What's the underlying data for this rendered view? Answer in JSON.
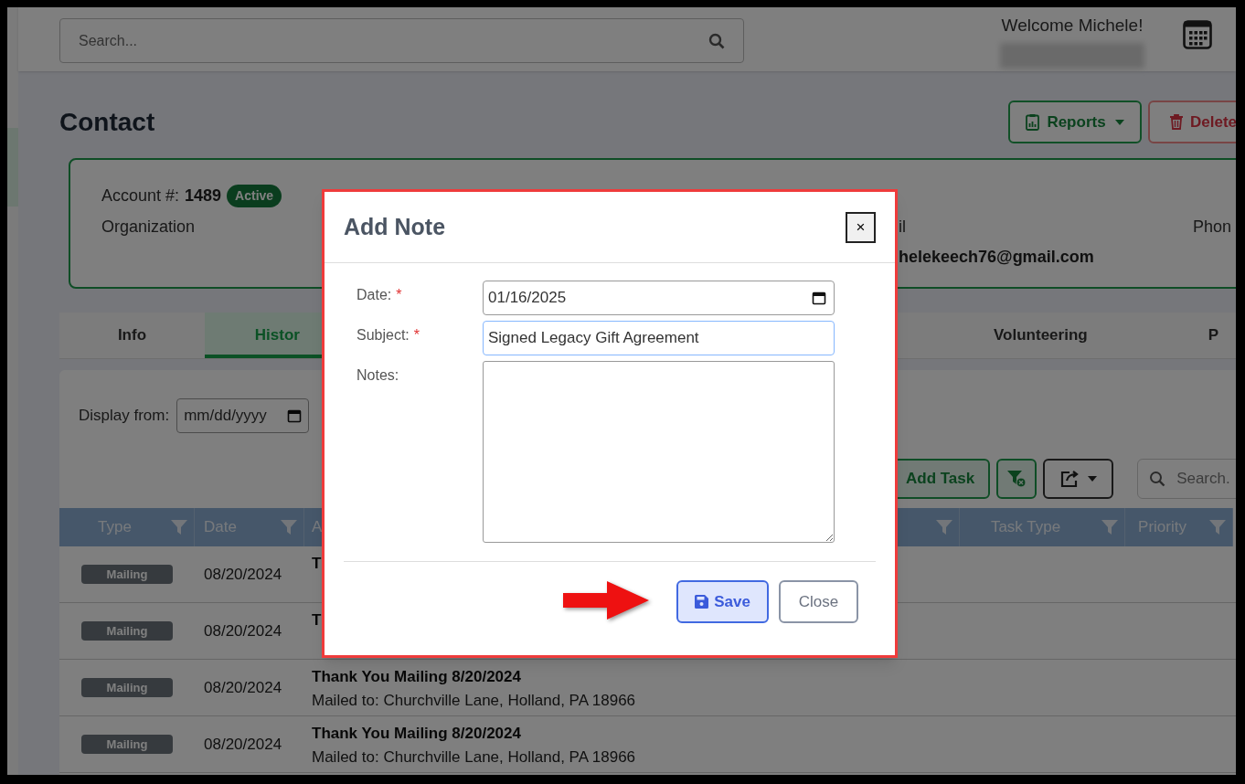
{
  "header": {
    "search_placeholder": "Search...",
    "welcome": "Welcome Michele!"
  },
  "page_title": "Contact",
  "actions": [
    {
      "kind": "reports",
      "label": "Reports"
    },
    {
      "kind": "delete",
      "label": "Delete"
    }
  ],
  "account": {
    "label": "Account #:",
    "number": "1489",
    "status": "Active",
    "fields": [
      {
        "label": "Organization"
      },
      {
        "label": "il",
        "value": "helekeech76@gmail.com"
      },
      {
        "label": "Phon"
      }
    ]
  },
  "tabs": [
    {
      "label": "Info",
      "selected": false
    },
    {
      "label": "Histor",
      "selected": true
    },
    {
      "label": "Volunteering",
      "selected": false
    },
    {
      "label": "P",
      "selected": false
    }
  ],
  "history": {
    "display_from_label": "Display from:",
    "date_placeholder": "mm/dd/yyyy",
    "add_task": "Add Task",
    "search_placeholder": "Search.",
    "columns": [
      {
        "label": "Type",
        "filterable": true
      },
      {
        "label": "Date",
        "filterable": true
      },
      {
        "label": "A",
        "filterable": false
      },
      {
        "filterable": true
      },
      {
        "label": "Task Type",
        "filterable": true
      },
      {
        "label": "Priority",
        "filterable": true
      }
    ],
    "rows": [
      {
        "type": "Mailing",
        "date": "08/20/2024",
        "title": "T"
      },
      {
        "type": "Mailing",
        "date": "08/20/2024",
        "title": "T"
      },
      {
        "type": "Mailing",
        "date": "08/20/2024",
        "title": "Thank You Mailing 8/20/2024",
        "detail": "Mailed to: Churchville Lane, Holland, PA 18966"
      },
      {
        "type": "Mailing",
        "date": "08/20/2024",
        "title": "Thank You Mailing 8/20/2024",
        "detail": "Mailed to: Churchville Lane, Holland, PA 18966"
      }
    ]
  },
  "modal": {
    "title": "Add Note",
    "close_symbol": "×",
    "fields": [
      {
        "kind": "date",
        "label": "Date:",
        "required_mark": "*",
        "value": "01/16/2025",
        "focused": false
      },
      {
        "kind": "text",
        "label": "Subject:",
        "required_mark": "*",
        "value": "Signed Legacy Gift Agreement",
        "focused": true
      },
      {
        "kind": "textarea",
        "label": "Notes:",
        "focused": false
      }
    ],
    "buttons": [
      {
        "kind": "primary",
        "label": "Save"
      },
      {
        "kind": "secondary",
        "label": "Close"
      }
    ]
  }
}
